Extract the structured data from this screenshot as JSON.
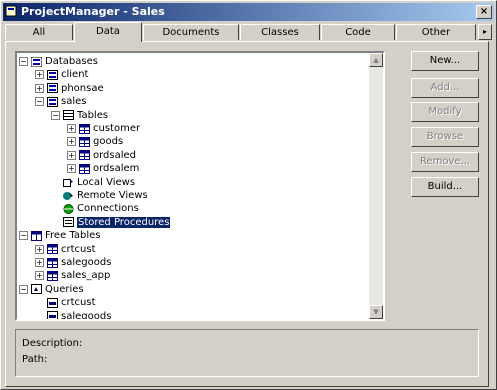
{
  "window": {
    "title": "ProjectManager - Sales",
    "close_glyph": "×"
  },
  "tabs": [
    {
      "label": "All"
    },
    {
      "label": "Data"
    },
    {
      "label": "Documents"
    },
    {
      "label": "Classes"
    },
    {
      "label": "Code"
    },
    {
      "label": "Other"
    }
  ],
  "active_tab": "Data",
  "tab_scroll_glyph": "▸",
  "tree": [
    {
      "label": "Databases",
      "icon": "databases-icon",
      "expander": "−"
    },
    {
      "label": "client",
      "icon": "database-icon",
      "expander": "+"
    },
    {
      "label": "phonsae",
      "icon": "database-icon",
      "expander": "+"
    },
    {
      "label": "sales",
      "icon": "database-icon",
      "expander": "−"
    },
    {
      "label": "Tables",
      "icon": "tables-icon",
      "expander": "−"
    },
    {
      "label": "customer",
      "icon": "table-icon",
      "expander": "+"
    },
    {
      "label": "goods",
      "icon": "table-icon",
      "expander": "+"
    },
    {
      "label": "ordsaled",
      "icon": "table-icon",
      "expander": "+"
    },
    {
      "label": "ordsalem",
      "icon": "table-icon",
      "expander": "+"
    },
    {
      "label": "Local Views",
      "icon": "local-views-icon",
      "expander": ""
    },
    {
      "label": "Remote Views",
      "icon": "remote-views-icon",
      "expander": ""
    },
    {
      "label": "Connections",
      "icon": "connections-icon",
      "expander": ""
    },
    {
      "label": "Stored Procedures",
      "icon": "stored-procedures-icon",
      "expander": "",
      "selected": true
    },
    {
      "label": "Free Tables",
      "icon": "free-tables-icon",
      "expander": "−"
    },
    {
      "label": "crtcust",
      "icon": "table-icon",
      "expander": "+"
    },
    {
      "label": "salegoods",
      "icon": "table-icon",
      "expander": "+"
    },
    {
      "label": "sales_app",
      "icon": "table-icon",
      "expander": "+"
    },
    {
      "label": "Queries",
      "icon": "queries-icon",
      "expander": "−"
    },
    {
      "label": "crtcust",
      "icon": "query-icon",
      "expander": ""
    },
    {
      "label": "salegoods",
      "icon": "query-icon",
      "expander": ""
    }
  ],
  "buttons": [
    {
      "label": "New...",
      "enabled": true
    },
    {
      "label": "Add...",
      "enabled": false
    },
    {
      "label": "Modify",
      "enabled": false
    },
    {
      "label": "Browse",
      "enabled": false
    },
    {
      "label": "Remove...",
      "enabled": false
    },
    {
      "label": "Build...",
      "enabled": true
    }
  ],
  "info": {
    "description_label": "Description:",
    "path_label": "Path:"
  },
  "colors": {
    "selection": "#0a246a",
    "title_start": "#0a246a",
    "title_end": "#a6caf0"
  },
  "scroll_glyphs": {
    "up": "▲",
    "down": "▼"
  }
}
